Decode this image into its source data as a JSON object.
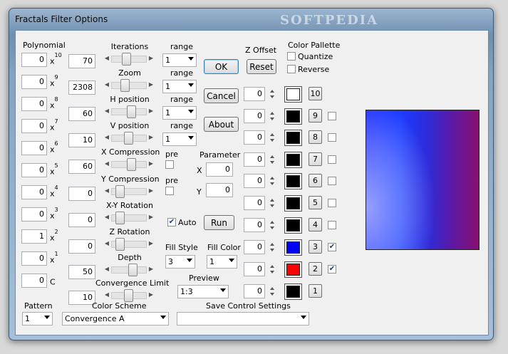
{
  "window": {
    "title": "Fractals Filter Options",
    "watermark": "SOFTPEDIA"
  },
  "polynomial": {
    "header": "Polynomial",
    "values": [
      "0",
      "0",
      "0",
      "0",
      "0",
      "0",
      "0",
      "0",
      "1",
      "0",
      "0"
    ],
    "powers": [
      {
        "base": "x",
        "exp": "10"
      },
      {
        "base": "x",
        "exp": "9"
      },
      {
        "base": "x",
        "exp": "8"
      },
      {
        "base": "x",
        "exp": "7"
      },
      {
        "base": "x",
        "exp": "6"
      },
      {
        "base": "x",
        "exp": "5"
      },
      {
        "base": "x",
        "exp": "4"
      },
      {
        "base": "x",
        "exp": "3"
      },
      {
        "base": "x",
        "exp": "2"
      },
      {
        "base": "x",
        "exp": "1"
      },
      {
        "base": "C",
        "exp": ""
      }
    ]
  },
  "params": [
    {
      "label": "Iterations",
      "value": "70",
      "slider": 0.35,
      "range": "1",
      "range_label": "range"
    },
    {
      "label": "Zoom",
      "value": "2308",
      "slider": 0.3,
      "range": "1",
      "range_label": "range"
    },
    {
      "label": "H position",
      "value": "60",
      "slider": 0.55,
      "range": "1",
      "range_label": "range"
    },
    {
      "label": "V position",
      "value": "10",
      "slider": 0.45,
      "range": "1",
      "range_label": "range"
    },
    {
      "label": "X Compression",
      "value": "60",
      "slider": 0.55,
      "pre": "pre"
    },
    {
      "label": "Y Compression",
      "value": "0",
      "slider": 0.1,
      "pre": "pre"
    },
    {
      "label": "X-Y Rotation",
      "value": "0",
      "slider": 0.1
    },
    {
      "label": "Z Rotation",
      "value": "0",
      "slider": 0.1
    },
    {
      "label": "Depth",
      "value": "50",
      "slider": 0.6
    },
    {
      "label": "Convergence Limit",
      "value": "10",
      "slider": 0.45
    }
  ],
  "buttons": {
    "ok": "OK",
    "cancel": "Cancel",
    "about": "About",
    "run": "Run",
    "reset": "Reset"
  },
  "parameter": {
    "label": "Parameter",
    "x_label": "X",
    "x_value": "0",
    "y_label": "Y",
    "y_value": "0"
  },
  "auto": {
    "label": "Auto",
    "checked": true
  },
  "fill_style": {
    "label": "Fill Style",
    "value": "3"
  },
  "fill_color": {
    "label": "Fill Color",
    "value": "1"
  },
  "preview": {
    "label": "Preview",
    "value": "1:3"
  },
  "z_offset": {
    "label": "Z Offset",
    "values": [
      "0",
      "0",
      "0",
      "0",
      "0",
      "0",
      "0",
      "0",
      "0",
      "0"
    ]
  },
  "color_palette": {
    "label": "Color Pallette",
    "quantize": "Quantize",
    "reverse": "Reverse",
    "swatches": [
      {
        "num": "10",
        "color": "#ffffff",
        "checkbox": false,
        "checked": false
      },
      {
        "num": "9",
        "color": "#000000",
        "checkbox": true,
        "checked": false
      },
      {
        "num": "8",
        "color": "#000000",
        "checkbox": true,
        "checked": false
      },
      {
        "num": "7",
        "color": "#000000",
        "checkbox": true,
        "checked": false
      },
      {
        "num": "6",
        "color": "#000000",
        "checkbox": true,
        "checked": false
      },
      {
        "num": "5",
        "color": "#000000",
        "checkbox": true,
        "checked": false
      },
      {
        "num": "4",
        "color": "#000000",
        "checkbox": true,
        "checked": false
      },
      {
        "num": "3",
        "color": "#0000ff",
        "checkbox": true,
        "checked": true
      },
      {
        "num": "2",
        "color": "#ff0000",
        "checkbox": true,
        "checked": true
      },
      {
        "num": "1",
        "color": "#000000",
        "checkbox": false,
        "checked": false
      }
    ]
  },
  "footer": {
    "pattern_label": "Pattern",
    "pattern_value": "1",
    "scheme_label": "Color Scheme",
    "scheme_value": "Convergence A",
    "save_label": "Save Control Settings",
    "save_value": ""
  }
}
